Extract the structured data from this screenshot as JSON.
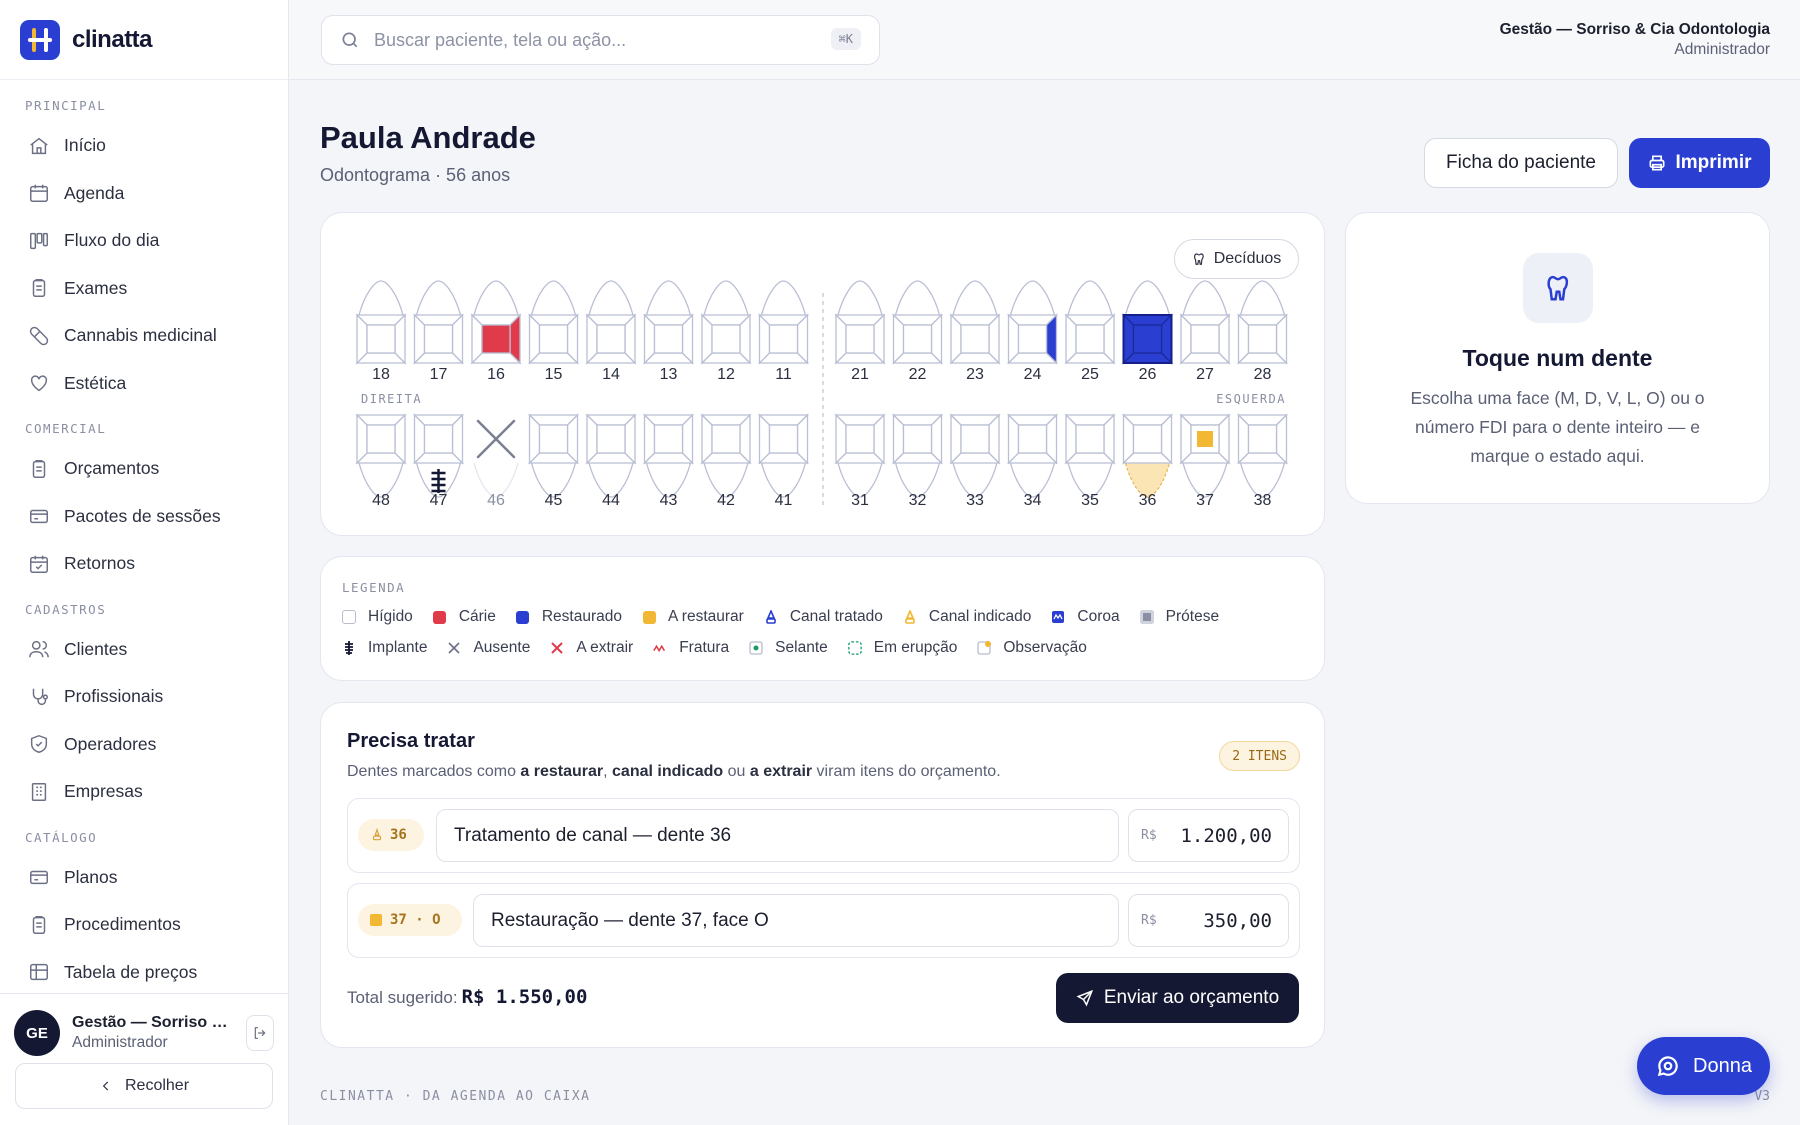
{
  "brand": {
    "name": "clinatta"
  },
  "sidebar": {
    "sections": [
      {
        "title": "PRINCIPAL",
        "items": [
          {
            "label": "Início",
            "icon": "home-icon"
          },
          {
            "label": "Agenda",
            "icon": "calendar-icon"
          },
          {
            "label": "Fluxo do dia",
            "icon": "kanban-icon"
          },
          {
            "label": "Exames",
            "icon": "clipboard-icon"
          },
          {
            "label": "Cannabis medicinal",
            "icon": "pill-icon"
          },
          {
            "label": "Estética",
            "icon": "heart-icon"
          }
        ]
      },
      {
        "title": "COMERCIAL",
        "items": [
          {
            "label": "Orçamentos",
            "icon": "clipboard-icon"
          },
          {
            "label": "Pacotes de sessões",
            "icon": "card-icon"
          },
          {
            "label": "Retornos",
            "icon": "calendar-check-icon"
          }
        ]
      },
      {
        "title": "CADASTROS",
        "items": [
          {
            "label": "Clientes",
            "icon": "users-icon"
          },
          {
            "label": "Profissionais",
            "icon": "stethoscope-icon"
          },
          {
            "label": "Operadores",
            "icon": "shield-icon"
          },
          {
            "label": "Empresas",
            "icon": "building-icon"
          }
        ]
      },
      {
        "title": "CATÁLOGO",
        "items": [
          {
            "label": "Planos",
            "icon": "card-icon"
          },
          {
            "label": "Procedimentos",
            "icon": "clipboard-icon"
          },
          {
            "label": "Tabela de preços",
            "icon": "table-icon"
          }
        ]
      }
    ],
    "user": {
      "initials": "GE",
      "name": "Gestão — Sorriso & Cia Odontologia",
      "role": "Administrador"
    },
    "collapse_label": "Recolher"
  },
  "search": {
    "placeholder": "Buscar paciente, tela ou ação...",
    "shortcut": "⌘K"
  },
  "org": {
    "name": "Gestão — Sorriso & Cia Odontologia",
    "role": "Administrador"
  },
  "patient": {
    "name": "Paula Andrade",
    "subtitle": "Odontograma · 56 anos"
  },
  "actions": {
    "ficha_label": "Ficha do paciente",
    "print_label": "Imprimir"
  },
  "odontogram": {
    "toggle_label": "Decíduos",
    "label_right": "DIREITA",
    "label_left": "ESQUERDA",
    "upper": [
      "18",
      "17",
      "16",
      "15",
      "14",
      "13",
      "12",
      "11",
      "21",
      "22",
      "23",
      "24",
      "25",
      "26",
      "27",
      "28"
    ],
    "lower": [
      "48",
      "47",
      "46",
      "45",
      "44",
      "43",
      "42",
      "41",
      "31",
      "32",
      "33",
      "34",
      "35",
      "36",
      "37",
      "38"
    ],
    "marks": [
      {
        "tooth": "16",
        "state": "carie",
        "face": "D"
      },
      {
        "tooth": "24",
        "state": "restaurado",
        "face": "M"
      },
      {
        "tooth": "26",
        "state": "coroa",
        "face": "all"
      },
      {
        "tooth": "46",
        "state": "ausente",
        "face": "all"
      },
      {
        "tooth": "47",
        "state": "implante",
        "face": "all"
      },
      {
        "tooth": "36",
        "state": "canal_indicado",
        "face": "root"
      },
      {
        "tooth": "37",
        "state": "a_restaurar",
        "face": "O"
      }
    ]
  },
  "hint": {
    "title": "Toque num dente",
    "text": "Escolha uma face (M, D, V, L, O) ou o número FDI para o dente inteiro — e marque o estado aqui."
  },
  "legend": {
    "title": "LEGENDA",
    "row1": [
      {
        "label": "Hígido",
        "key": "higido",
        "color": "#ffffff"
      },
      {
        "label": "Cárie",
        "key": "carie",
        "color": "#e03b4a"
      },
      {
        "label": "Restaurado",
        "key": "restaurado",
        "color": "#2a3fd1"
      },
      {
        "label": "A restaurar",
        "key": "a_restaurar",
        "color": "#f2b733"
      },
      {
        "label": "Canal tratado",
        "key": "canal_tratado",
        "color": "#2a3fd1"
      },
      {
        "label": "Canal indicado",
        "key": "canal_indicado",
        "color": "#f2b733"
      },
      {
        "label": "Coroa",
        "key": "coroa",
        "color": "#2a3fd1"
      },
      {
        "label": "Prótese",
        "key": "protese",
        "color": "#8a8fa3"
      }
    ],
    "row2": [
      {
        "label": "Implante",
        "key": "implante",
        "color": "#141833"
      },
      {
        "label": "Ausente",
        "key": "ausente",
        "color": "#6b7085"
      },
      {
        "label": "A extrair",
        "key": "a_extrair",
        "color": "#e03b4a"
      },
      {
        "label": "Fratura",
        "key": "fratura",
        "color": "#e03b4a"
      },
      {
        "label": "Selante",
        "key": "selante",
        "color": "#1a9a6b"
      },
      {
        "label": "Em erupção",
        "key": "em_erupcao",
        "color": "#1a9a6b"
      },
      {
        "label": "Observação",
        "key": "observacao",
        "color": "#f2b733"
      }
    ]
  },
  "treatment": {
    "title": "Precisa tratar",
    "desc_pre": "Dentes marcados como ",
    "desc_b1": "a restaurar",
    "desc_sep1": ", ",
    "desc_b2": "canal indicado",
    "desc_sep2": " ou ",
    "desc_b3": "a extrair",
    "desc_post": " viram itens do orçamento.",
    "badge": "2 ITENS",
    "items": [
      {
        "tag": "36",
        "description": "Tratamento de canal — dente 36",
        "currency": "R$",
        "price": "1.200,00"
      },
      {
        "tag": "37 · O",
        "description": "Restauração — dente 37, face O",
        "currency": "R$",
        "price": "350,00"
      }
    ],
    "total_label": "Total sugerido:",
    "total_value": "R$ 1.550,00",
    "send_label": "Enviar ao orçamento"
  },
  "footer": {
    "text": "CLINATTA · DA AGENDA AO CAIXA",
    "version": "V3"
  },
  "assistant": {
    "label": "Donna"
  },
  "colors": {
    "accent": "#2a3fd1",
    "dark": "#141833",
    "caries": "#e03b4a",
    "pending": "#f2b733"
  }
}
